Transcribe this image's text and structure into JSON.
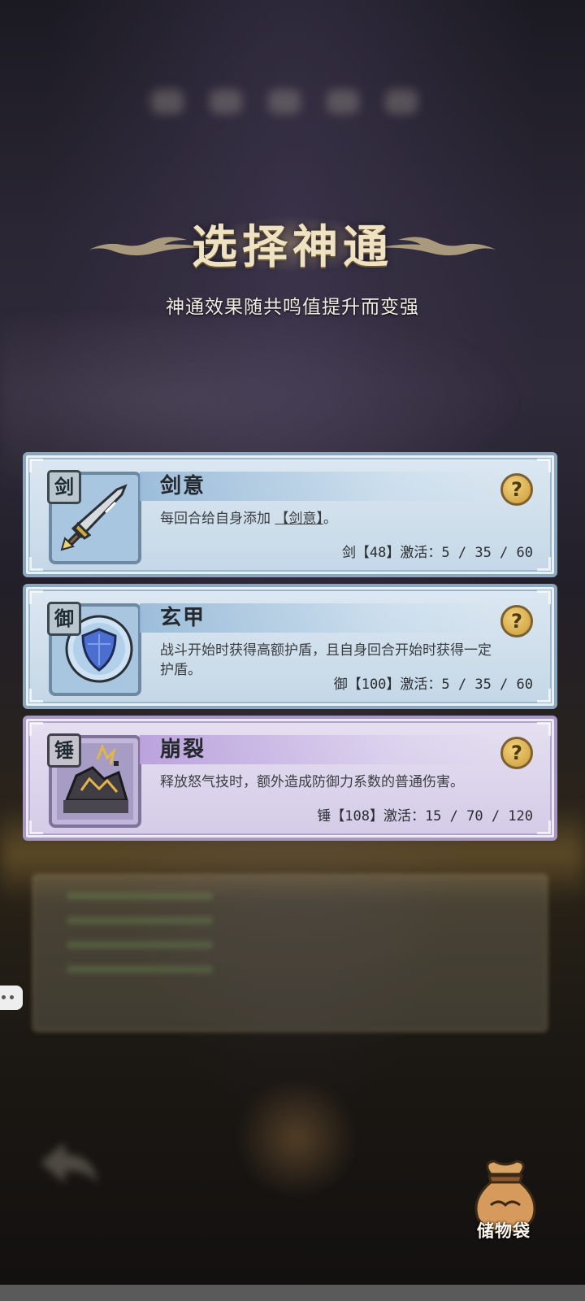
{
  "screen": {
    "title": "选择神通",
    "subtitle": "神通效果随共鸣值提升而变强"
  },
  "cards": [
    {
      "theme": "blue",
      "tag": "剑",
      "name": "剑意",
      "description_parts": [
        "每回合给自身添加",
        "【剑意】",
        "。"
      ],
      "stat": "剑【48】激活：5 / 35 / 60",
      "help_label": "?",
      "icon": "sword-icon"
    },
    {
      "theme": "blue",
      "tag": "御",
      "name": "玄甲",
      "description": "战斗开始时获得高额护盾，且自身回合开始时获得一定护盾。",
      "stat": "御【100】激活：5 / 35 / 60",
      "help_label": "?",
      "icon": "shield-icon"
    },
    {
      "theme": "purple",
      "tag": "锤",
      "name": "崩裂",
      "description": "释放怒气技时，额外造成防御力系数的普通伤害。",
      "stat": "锤【108】激活：15 / 70 / 120",
      "help_label": "?",
      "icon": "shatter-rock-icon"
    }
  ],
  "storage": {
    "label": "储物袋",
    "icon": "storage-bag-icon"
  },
  "colors": {
    "blue_card": "#c4d7e6",
    "purple_card": "#d4cbe7",
    "title": "#efe2c2",
    "help_button": "#e2b556"
  }
}
